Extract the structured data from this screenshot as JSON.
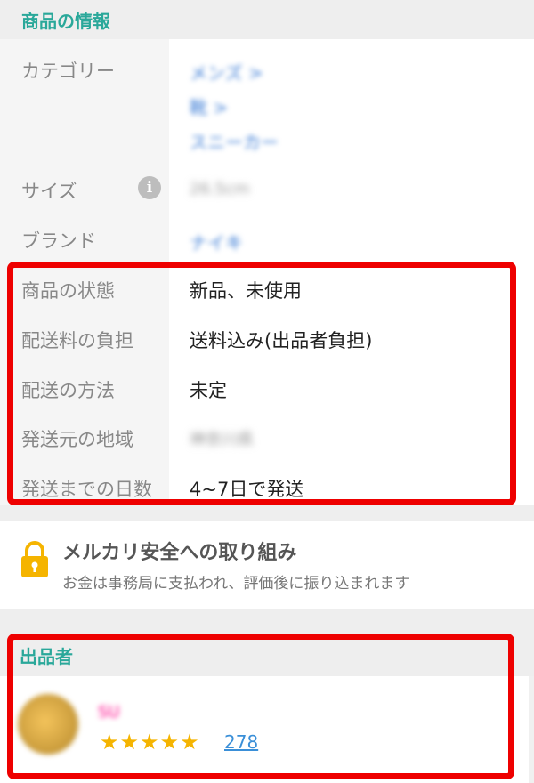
{
  "section_product_info": {
    "title": "商品の情報"
  },
  "rows": {
    "category": {
      "label": "カテゴリー",
      "values": [
        "メンズ >",
        "靴 >",
        "スニーカー"
      ]
    },
    "size": {
      "label": "サイズ",
      "value": "26.5cm"
    },
    "brand": {
      "label": "ブランド",
      "value": "ナイキ"
    },
    "condition": {
      "label": "商品の状態",
      "value": "新品、未使用"
    },
    "shipping_fee": {
      "label": "配送料の負担",
      "value": "送料込み(出品者負担)"
    },
    "shipping_method": {
      "label": "配送の方法",
      "value": "未定"
    },
    "ship_from": {
      "label": "発送元の地域",
      "value": "神奈川県"
    },
    "ship_days": {
      "label": "発送までの日数",
      "value": "4~7日で発送"
    }
  },
  "safety": {
    "title": "メルカリ安全への取り組み",
    "subtitle": "お金は事務局に支払われ、評価後に振り込まれます"
  },
  "seller": {
    "section_title": "出品者",
    "name": "SU",
    "stars": "★★★★★",
    "rating_count": "278"
  },
  "colors": {
    "accent": "#2aa89a",
    "highlight": "#ee0000",
    "star": "#f5b400",
    "link": "#3a8fd8"
  }
}
